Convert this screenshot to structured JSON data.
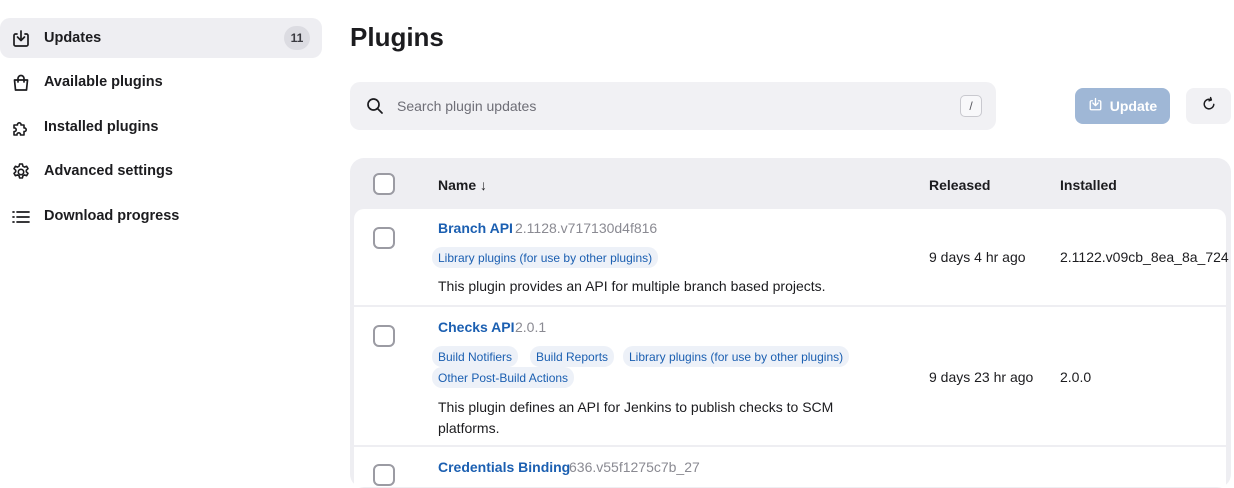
{
  "sidebar": {
    "items": [
      {
        "label": "Updates",
        "badge": "11",
        "icon": "download-icon",
        "active": true
      },
      {
        "label": "Available plugins",
        "icon": "shopping-bag-icon"
      },
      {
        "label": "Installed plugins",
        "icon": "puzzle-icon"
      },
      {
        "label": "Advanced settings",
        "icon": "gear-icon"
      },
      {
        "label": "Download progress",
        "icon": "list-icon"
      }
    ]
  },
  "page": {
    "title": "Plugins"
  },
  "search": {
    "placeholder": "Search plugin updates",
    "value": "",
    "shortcut": "/"
  },
  "toolbar": {
    "update_label": "Update",
    "update_color": "#9fb7d6"
  },
  "table": {
    "columns": {
      "name": "Name ↓",
      "released": "Released",
      "installed": "Installed"
    },
    "rows": [
      {
        "name": "Branch API",
        "version": "2.1128.v717130d4f816",
        "tags": [
          "Library plugins (for use by other plugins)"
        ],
        "description": "This plugin provides an API for multiple branch based projects.",
        "released": "9 days 4 hr ago",
        "installed": "2.1122.v09cb_8ea_8a_724"
      },
      {
        "name": "Checks API",
        "version": "2.0.1",
        "tags": [
          "Build Notifiers",
          "Build Reports",
          "Library plugins (for use by other plugins)",
          "Other Post-Build Actions"
        ],
        "description_line1": "This plugin defines an API for Jenkins to publish checks to SCM",
        "description_line2": "platforms.",
        "released": "9 days 23 hr ago",
        "installed": "2.0.0"
      },
      {
        "name": "Credentials Binding",
        "version": "636.v55f1275c7b_27"
      }
    ]
  },
  "colors": {
    "link": "#1b5fb1",
    "accent": "#9fb7d6",
    "surface": "#eeeef2"
  }
}
